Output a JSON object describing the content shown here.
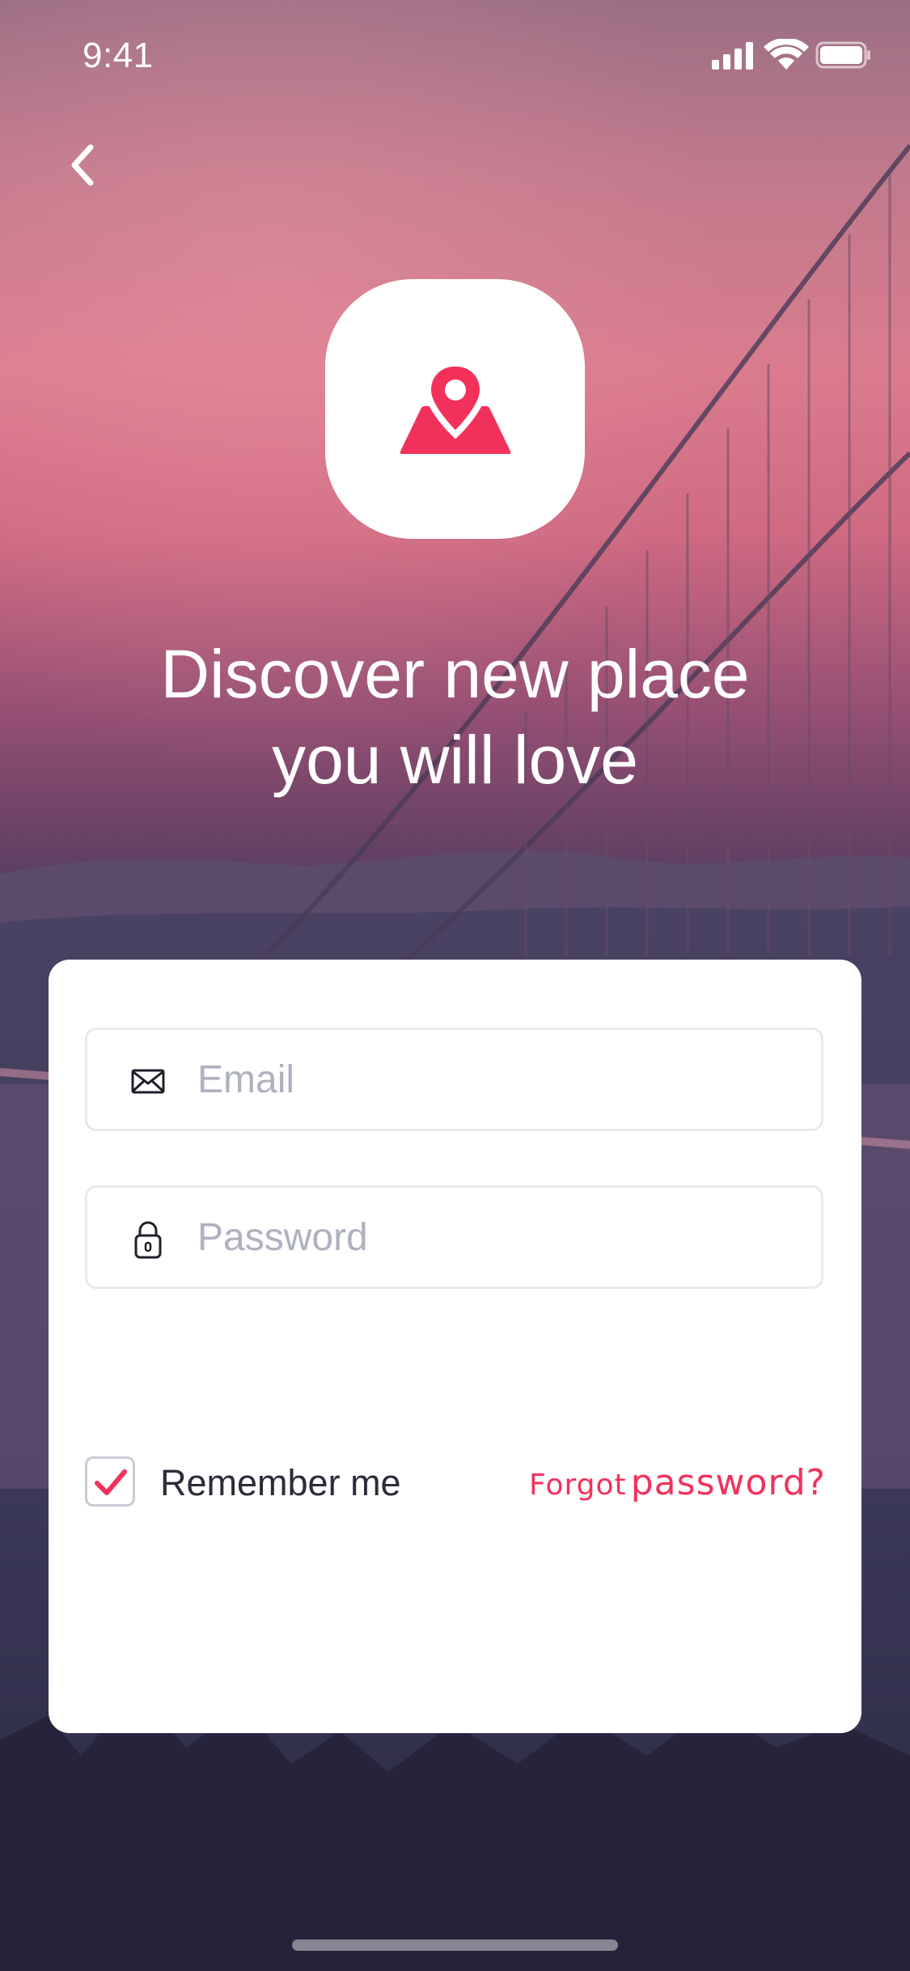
{
  "status_bar": {
    "time": "9:41",
    "icons": [
      "cellular-signal-icon",
      "wifi-icon",
      "battery-icon"
    ]
  },
  "navigation": {
    "back_icon": "chevron-left-icon"
  },
  "logo": {
    "icon": "location-pin-map-icon",
    "accent_color": "#f2315b"
  },
  "headline": {
    "line1": "Discover new place",
    "line2": "you will love"
  },
  "form": {
    "email": {
      "icon": "envelope-icon",
      "placeholder": "Email",
      "value": ""
    },
    "password": {
      "icon": "lock-icon",
      "placeholder": "Password",
      "value": ""
    },
    "remember": {
      "label": "Remember me",
      "checked": true
    },
    "forgot": {
      "word1": "Forgot",
      "word2": "password?"
    }
  },
  "colors": {
    "accent": "#f2315b",
    "card": "#ffffff",
    "placeholder": "#aeb1bf",
    "field_border": "#e7e9ee"
  }
}
